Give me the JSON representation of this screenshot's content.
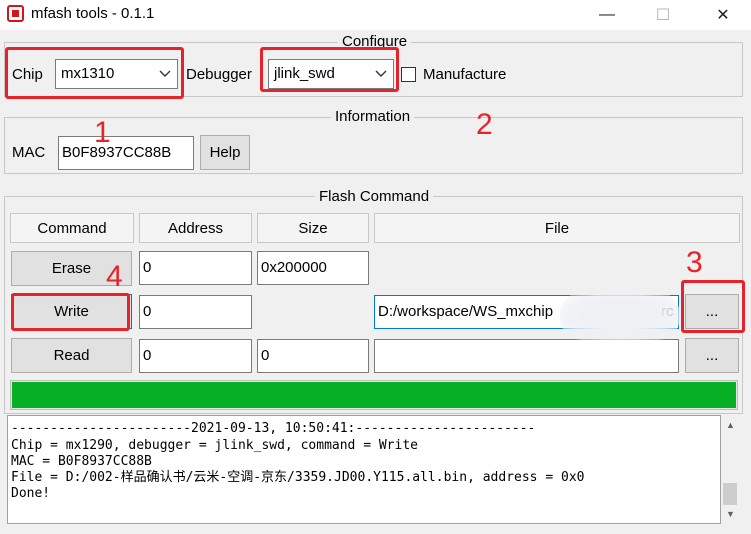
{
  "window": {
    "title": "mfash tools - 0.1.1",
    "minimize_glyph": "—",
    "maximize_glyph": "☐",
    "close_glyph": "✕"
  },
  "configure": {
    "title": "Configure",
    "chip_label": "Chip",
    "chip_value": "mx1310",
    "debugger_label": "Debugger",
    "debugger_value": "jlink_swd",
    "manufacture_label": "Manufacture",
    "manufacture_checked": false
  },
  "information": {
    "title": "Information",
    "mac_label": "MAC",
    "mac_value": "B0F8937CC88B",
    "help_label": "Help"
  },
  "flash": {
    "title": "Flash Command",
    "headers": [
      "Command",
      "Address",
      "Size",
      "File"
    ],
    "rows": [
      {
        "command": "Erase",
        "address": "0",
        "size": "0x200000",
        "file": "",
        "browse": ""
      },
      {
        "command": "Write",
        "address": "0",
        "size": "",
        "file": "D:/workspace/WS_mxchip",
        "file_tail": "rc",
        "browse": "..."
      },
      {
        "command": "Read",
        "address": "0",
        "size": "0",
        "file": "",
        "browse": "..."
      }
    ]
  },
  "progress": {
    "percent": 100,
    "color": "#06b025"
  },
  "log": {
    "lines": [
      "Done!",
      "-----------------------2021-09-13, 10:50:41:-----------------------",
      "Chip = mx1290, debugger = jlink_swd, command = Write",
      "MAC = B0F8937CC88B",
      "File = D:/002-样品确认书/云米-空调-京东/3359.JD00.Y115.all.bin, address = 0x0",
      "Done!"
    ]
  },
  "annotations": {
    "color": "#e8222a",
    "labels": [
      "1",
      "2",
      "3",
      "4"
    ]
  }
}
